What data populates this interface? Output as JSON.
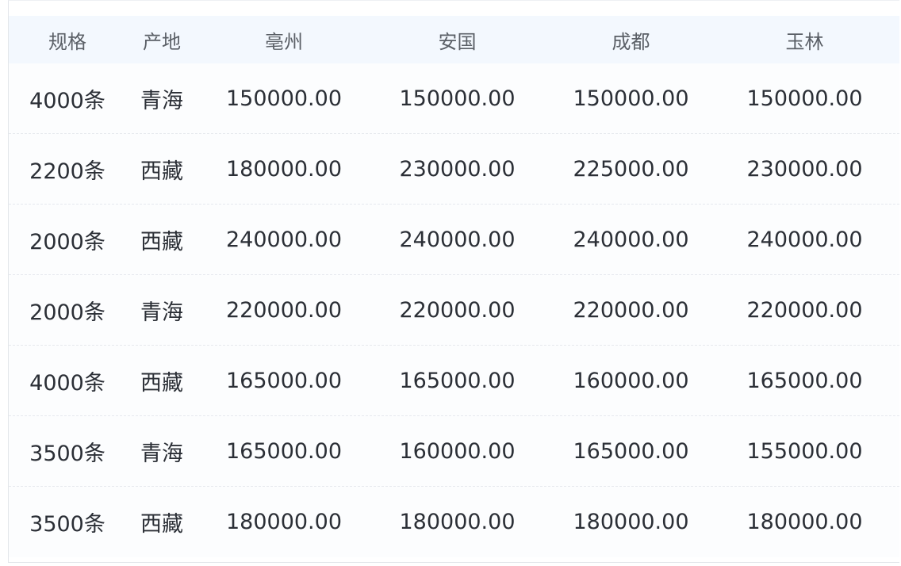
{
  "table": {
    "columns": [
      "规格",
      "产地",
      "亳州",
      "安国",
      "成都",
      "玉林"
    ],
    "rows": [
      [
        "4000条",
        "青海",
        "150000.00",
        "150000.00",
        "150000.00",
        "150000.00"
      ],
      [
        "2200条",
        "西藏",
        "180000.00",
        "230000.00",
        "225000.00",
        "230000.00"
      ],
      [
        "2000条",
        "西藏",
        "240000.00",
        "240000.00",
        "240000.00",
        "240000.00"
      ],
      [
        "2000条",
        "青海",
        "220000.00",
        "220000.00",
        "220000.00",
        "220000.00"
      ],
      [
        "4000条",
        "西藏",
        "165000.00",
        "165000.00",
        "160000.00",
        "165000.00"
      ],
      [
        "3500条",
        "青海",
        "165000.00",
        "160000.00",
        "165000.00",
        "155000.00"
      ],
      [
        "3500条",
        "西藏",
        "180000.00",
        "180000.00",
        "180000.00",
        "180000.00"
      ]
    ]
  }
}
